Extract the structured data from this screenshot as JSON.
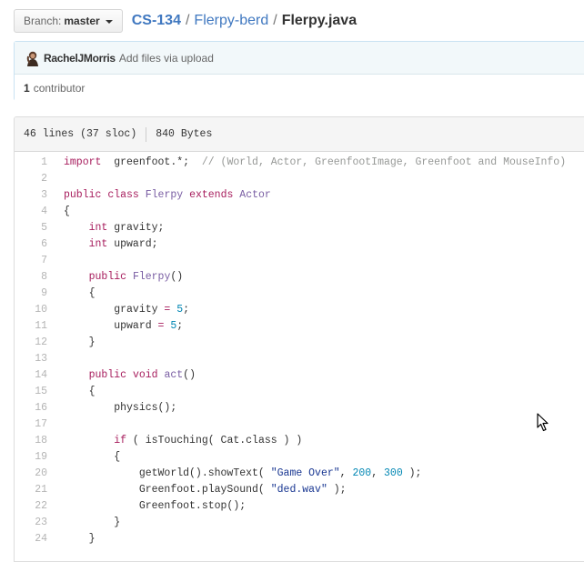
{
  "branch": {
    "prefix": "Branch:",
    "name": "master"
  },
  "breadcrumb": {
    "repo": "CS-134",
    "sep1": "/",
    "folder": "Flerpy-berd",
    "sep2": "/",
    "file": "Flerpy.java"
  },
  "commit": {
    "author": "RachelJMorris",
    "message": "Add files via upload"
  },
  "contributors": {
    "count": "1",
    "label": "contributor"
  },
  "file_info": {
    "lines": "46 lines (37 sloc)",
    "size": "840 Bytes"
  },
  "code": {
    "numbers": [
      "1",
      "2",
      "3",
      "4",
      "5",
      "6",
      "7",
      "8",
      "9",
      "10",
      "11",
      "12",
      "13",
      "14",
      "15",
      "16",
      "17",
      "18",
      "19",
      "20",
      "21",
      "22",
      "23",
      "24"
    ],
    "lines": [
      [
        [
          "kw",
          "import"
        ],
        [
          "",
          "  greenfoot.*;  "
        ],
        [
          "cm",
          "// (World, Actor, GreenfootImage, Greenfoot and MouseInfo)"
        ]
      ],
      [],
      [
        [
          "kw",
          "public"
        ],
        [
          "",
          " "
        ],
        [
          "kw",
          "class"
        ],
        [
          "",
          " "
        ],
        [
          "cl",
          "Flerpy"
        ],
        [
          "",
          " "
        ],
        [
          "kw",
          "extends"
        ],
        [
          "",
          " "
        ],
        [
          "cl",
          "Actor"
        ]
      ],
      [
        [
          "",
          "{"
        ]
      ],
      [
        [
          "",
          "    "
        ],
        [
          "ty",
          "int"
        ],
        [
          "",
          " gravity;"
        ]
      ],
      [
        [
          "",
          "    "
        ],
        [
          "ty",
          "int"
        ],
        [
          "",
          " upward;"
        ]
      ],
      [],
      [
        [
          "",
          "    "
        ],
        [
          "kw",
          "public"
        ],
        [
          "",
          " "
        ],
        [
          "cl",
          "Flerpy"
        ],
        [
          "",
          "()"
        ]
      ],
      [
        [
          "",
          "    {"
        ]
      ],
      [
        [
          "",
          "        gravity "
        ],
        [
          "kw",
          "="
        ],
        [
          "",
          " "
        ],
        [
          "num",
          "5"
        ],
        [
          "",
          ";"
        ]
      ],
      [
        [
          "",
          "        upward "
        ],
        [
          "kw",
          "="
        ],
        [
          "",
          " "
        ],
        [
          "num",
          "5"
        ],
        [
          "",
          ";"
        ]
      ],
      [
        [
          "",
          "    }"
        ]
      ],
      [],
      [
        [
          "",
          "    "
        ],
        [
          "kw",
          "public"
        ],
        [
          "",
          " "
        ],
        [
          "ty",
          "void"
        ],
        [
          "",
          " "
        ],
        [
          "cl",
          "act"
        ],
        [
          "",
          "()"
        ]
      ],
      [
        [
          "",
          "    {"
        ]
      ],
      [
        [
          "",
          "        physics();"
        ]
      ],
      [],
      [
        [
          "",
          "        "
        ],
        [
          "kw",
          "if"
        ],
        [
          "",
          " ( isTouching( Cat.class ) )"
        ]
      ],
      [
        [
          "",
          "        {"
        ]
      ],
      [
        [
          "",
          "            getWorld().showText( "
        ],
        [
          "str",
          "\"Game Over\""
        ],
        [
          "",
          ", "
        ],
        [
          "num",
          "200"
        ],
        [
          "",
          ", "
        ],
        [
          "num",
          "300"
        ],
        [
          "",
          " );"
        ]
      ],
      [
        [
          "",
          "            Greenfoot.playSound( "
        ],
        [
          "str",
          "\"ded.wav\""
        ],
        [
          "",
          " );"
        ]
      ],
      [
        [
          "",
          "            Greenfoot.stop();"
        ]
      ],
      [
        [
          "",
          "        }"
        ]
      ],
      [
        [
          "",
          "    }"
        ]
      ]
    ]
  }
}
